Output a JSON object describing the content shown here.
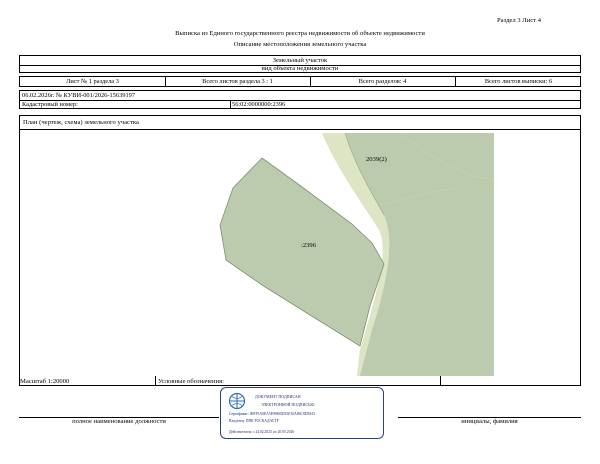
{
  "header": {
    "section_sheet": "Раздел 3   Лист 4",
    "title": "Выписка из Единого государственного реестра недвижимости об объекте недвижимости",
    "subtitle": "Описание местоположения земельного участка"
  },
  "object": {
    "type": "Земельный участок",
    "caption": "вид объекта недвижимости"
  },
  "sheet_info": {
    "sheet_of_section": "Лист № 1 раздела 3",
    "section_sheets": "Всего листов раздела 3 : 1",
    "total_sections": "Всего разделов: 4",
    "total_sheets": "Всего листов выписки: 6"
  },
  "extract_line": "06.02.2026г. № КУВИ-001/2026-15639197",
  "cadastral": {
    "label": "Кадастровый номер:",
    "value": "56:02:0000000:2396"
  },
  "plan": {
    "title": "План (чертеж, схема) земельного участка",
    "parcel_label": ":2396",
    "neighbor_label": "2039(2)",
    "colors": {
      "parcel": "#bccbae",
      "road": "#dde5c4",
      "edge": "#7f8f73"
    }
  },
  "footer": {
    "scale": "Масштаб 1:20000",
    "legend_label": "Условные обозначения:",
    "position_label": "полное наименование должности",
    "initials_label": "инициалы, фамилия"
  },
  "signature_stamp": {
    "line1": "ДОКУМЕНТ ПОДПИСАН",
    "line2": "ЭЛЕКТРОННОЙ ПОДПИСЬЮ",
    "certificate": "Сертификат: 00FF5A0EA5F09800D35E30A86C8D5843",
    "owner": "Владелец: ППК РОСКАДАСТР",
    "validity": "Действителен: с 24.02.2025 по 20.05.2026"
  }
}
